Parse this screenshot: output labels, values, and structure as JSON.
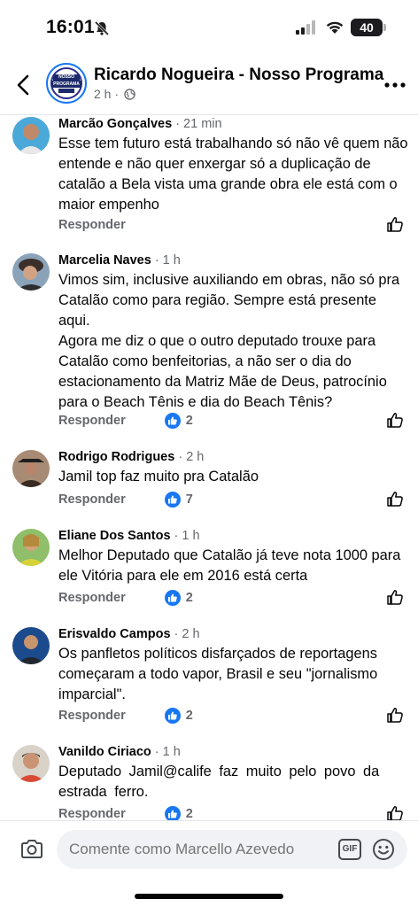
{
  "status_bar": {
    "time": "16:01",
    "battery": "40",
    "battery_level": 0.4
  },
  "header": {
    "title": "Ricardo Nogueira - Nosso Programa",
    "meta_time": "2 h ·",
    "avatar_logo_top": "NOSSO",
    "avatar_logo_bottom": "PROGRAMA"
  },
  "comments": [
    {
      "author": "Marcão Gonçalves",
      "time": "· 21 min",
      "text": "Esse tem futuro está trabalhando só não vê quem não entende e não quer enxergar só a duplicação de catalão a Bela vista uma grande obra ele está com o maior empenho",
      "reply": "Responder",
      "reactions": ""
    },
    {
      "author": "Marcelia Naves",
      "time": "· 1 h",
      "text": "Vimos sim, inclusive auxiliando em obras, não só pra Catalão como para região. Sempre está presente aqui.\nAgora me diz o que o outro deputado trouxe para Catalão como benfeitorias, a não ser o dia do estacionamento da Matriz Mãe de Deus, patrocínio para o Beach Tênis e dia do Beach Tênis?",
      "reply": "Responder",
      "reactions": "2"
    },
    {
      "author": "Rodrigo Rodrigues",
      "time": "· 2 h",
      "text": "Jamil top faz muito pra Catalão",
      "reply": "Responder",
      "reactions": "7"
    },
    {
      "author": "Eliane Dos Santos",
      "time": "· 1 h",
      "text": "Melhor Deputado que Catalão já teve nota 1000 para ele Vitória para ele em 2016 está certa",
      "reply": "Responder",
      "reactions": "2"
    },
    {
      "author": "Erisvaldo Campos",
      "time": "· 2 h",
      "text": "Os panfletos políticos disfarçados de reportagens começaram a todo vapor, Brasil e seu \"jornalismo imparcial\".",
      "reply": "Responder",
      "reactions": "2"
    },
    {
      "author": "Vanildo Ciriaco",
      "time": "· 1 h",
      "text": "Deputado Jamil@calife faz muito pelo povo da estrada ferro.",
      "reply": "Responder",
      "reactions": "2"
    }
  ],
  "composer": {
    "placeholder": "Comente como Marcello Azevedo",
    "gif_label": "GIF"
  },
  "colors": {
    "accent": "#1877f2",
    "secondary_text": "#65676b",
    "input_bg": "#f0f2f5"
  }
}
